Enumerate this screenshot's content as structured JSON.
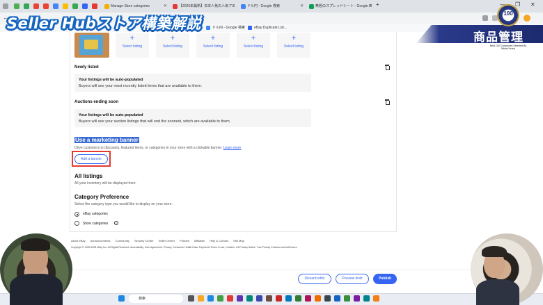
{
  "browser": {
    "tabs": [
      {
        "label": "Manage Store categories"
      },
      {
        "label": "【2025年最新】日本人気の人気アニ"
      },
      {
        "label": "ドル円 - Google 検索"
      },
      {
        "label": "無題のスプレッドシート - Google ス"
      }
    ],
    "window_controls": [
      "—",
      "❐",
      "✕"
    ],
    "bookmarks": [
      {
        "label": "ドル円 - Google 検索"
      },
      {
        "label": "eBay Duplicate List..."
      }
    ]
  },
  "overlay": {
    "title": "Seller Hubストア構築解説",
    "section_label": "商品管理",
    "badge_number": "100",
    "badge_caption": "Best 100 Companies Selected By Nikkei Keizai"
  },
  "page": {
    "select_listing_slots": [
      "Select listing",
      "Select listing",
      "Select listing",
      "Select listing",
      "Select listing"
    ],
    "newly_listed": {
      "title": "Newly listed",
      "box_title": "Your listings will be auto-populated",
      "box_desc": "Buyers will see your most recently listed items that are available to them."
    },
    "auctions_ending": {
      "title": "Auctions ending soon",
      "box_title": "Your listings will be auto-populated",
      "box_desc": "Buyers will see your auction listings that will end the soonest, which are available to them."
    },
    "marketing_banner": {
      "title": "Use a marketing banner",
      "desc": "Drive customers to discounts, featured items, or categories in your store with a clickable banner.",
      "learn_more": "Learn more",
      "add_button": "Add a banner"
    },
    "all_listings": {
      "title": "All listings",
      "desc": "All your inventory will be displayed here."
    },
    "category_preference": {
      "title": "Category Preference",
      "desc": "Select the category type you would like to display on your store.",
      "options": [
        "eBay categories",
        "Store categories"
      ],
      "selected": "eBay categories"
    }
  },
  "footer": {
    "links": [
      "About eBay",
      "Announcements",
      "Community",
      "Security Center",
      "Seller Center",
      "Policies",
      "Affiliates",
      "Help & Contact",
      "Site Map"
    ],
    "copyright": "Copyright © 1995-2025 eBay Inc. All Rights Reserved. Accessibility, User Agreement, Privacy, Consumer Health Data, Payments Terms of use, Cookies, CA Privacy Notice, Your Privacy Choices and AdChoices"
  },
  "actions": {
    "discard": "Discard edits",
    "preview": "Preview draft",
    "publish": "Publish"
  },
  "taskbar": {
    "search_placeholder": "検索"
  }
}
